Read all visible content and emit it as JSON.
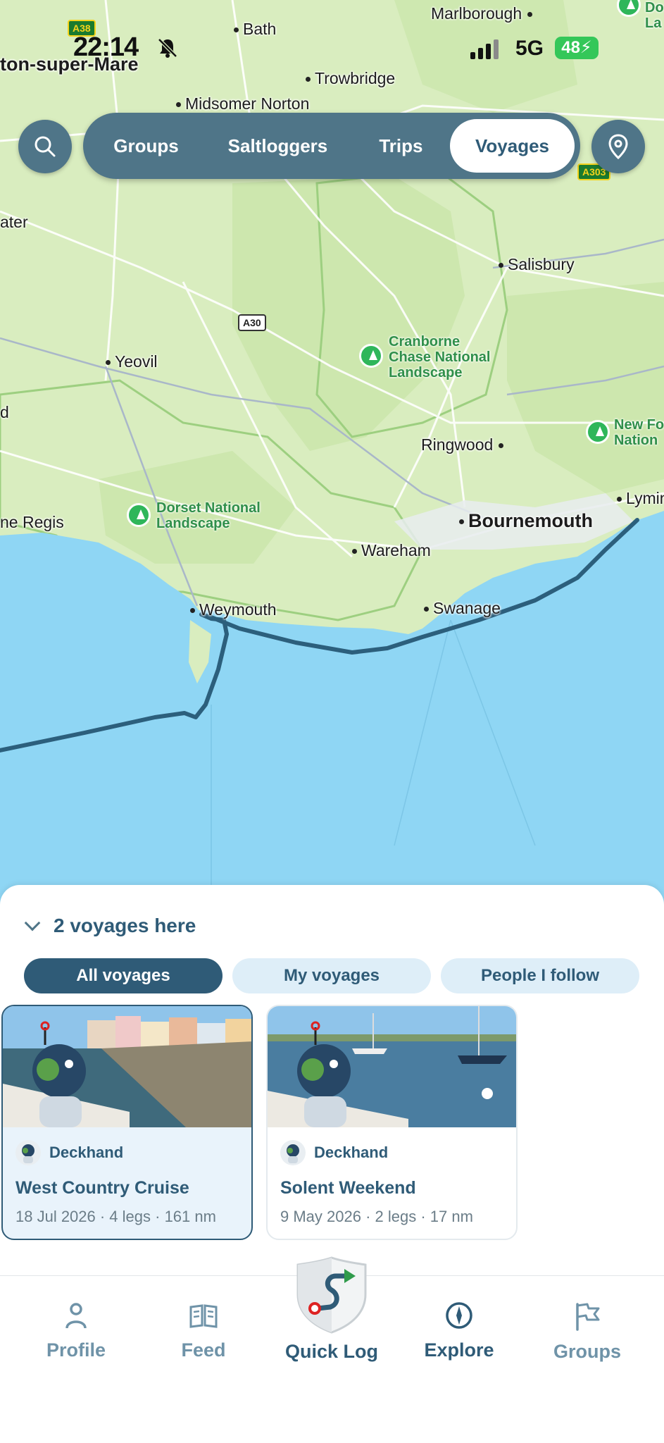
{
  "status_bar": {
    "time": "22:14",
    "network": "5G",
    "battery": "48"
  },
  "map": {
    "places": {
      "marlborough": "Marlborough",
      "bath": "Bath",
      "weston": "ton-super-Mare",
      "trowbridge": "Trowbridge",
      "midsomer": "Midsomer Norton",
      "ater": "ater",
      "salisbury": "Salisbury",
      "yeovil": "Yeovil",
      "d": "d",
      "ringwood": "Ringwood",
      "lyme_regis": "ne Regis",
      "bournemouth": "Bournemouth",
      "lymington": "Lymin",
      "wareham": "Wareham",
      "weymouth": "Weymouth",
      "swanage": "Swanage"
    },
    "parks": {
      "cranborne": "Cranborne\nChase National\nLandscape",
      "dorset": "Dorset National\nLandscape",
      "new_forest": "New Fo\nNation",
      "top_right": "Do\nLa"
    },
    "roads": {
      "a38": "A38",
      "a30": "A30",
      "a303": "A303"
    },
    "colors": {
      "land": "#d9edbf",
      "sea": "#8fd6f4",
      "route": "#2c5f7c"
    }
  },
  "top_nav": {
    "tabs": [
      {
        "label": "Groups",
        "active": false
      },
      {
        "label": "Saltloggers",
        "active": false
      },
      {
        "label": "Trips",
        "active": false
      },
      {
        "label": "Voyages",
        "active": true
      }
    ]
  },
  "sheet": {
    "title": "2 voyages here",
    "filters": [
      {
        "label": "All voyages",
        "active": true
      },
      {
        "label": "My voyages",
        "active": false
      },
      {
        "label": "People I follow",
        "active": false
      }
    ],
    "cards": [
      {
        "author": "Deckhand",
        "title": "West Country Cruise",
        "meta": "18 Jul 2026 · 4 legs · 161 nm",
        "selected": true
      },
      {
        "author": "Deckhand",
        "title": "Solent Weekend",
        "meta": "9 May 2026 · 2 legs · 17 nm",
        "selected": false
      }
    ]
  },
  "tab_bar": {
    "profile": "Profile",
    "feed": "Feed",
    "quick_log": "Quick Log",
    "explore": "Explore",
    "groups": "Groups"
  }
}
